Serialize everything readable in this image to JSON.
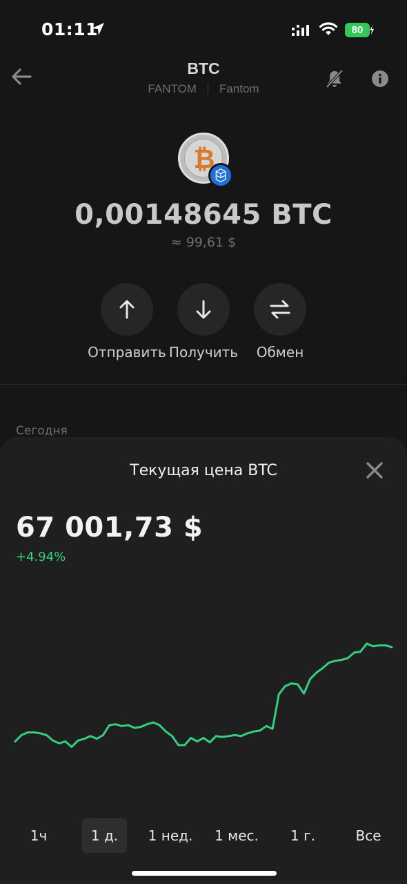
{
  "status_bar": {
    "time": "01:11",
    "battery": "80"
  },
  "header": {
    "title": "BTC",
    "network": "FANTOM",
    "network_name": "Fantom"
  },
  "asset": {
    "balance": "0,00148645 BTC",
    "fiat_value": "≈ 99,61 $"
  },
  "actions": [
    {
      "label": "Отправить",
      "icon": "arrow-up-icon"
    },
    {
      "label": "Получить",
      "icon": "arrow-down-icon"
    },
    {
      "label": "Обмен",
      "icon": "swap-icon"
    }
  ],
  "history": {
    "section_label": "Сегодня"
  },
  "price_sheet": {
    "title": "Текущая цена BTC",
    "price": "67 001,73 $",
    "change": "+4.94%",
    "ranges": [
      {
        "label": "1ч",
        "active": false
      },
      {
        "label": "1 д.",
        "active": true
      },
      {
        "label": "1 нед.",
        "active": false
      },
      {
        "label": "1 мес.",
        "active": false
      },
      {
        "label": "1 г.",
        "active": false
      },
      {
        "label": "Все",
        "active": false
      }
    ]
  },
  "colors": {
    "accent_green": "#35d07f",
    "background": "#161616",
    "sheet": "#1f1f1f",
    "btc_orange": "#d87a2a",
    "fantom_blue": "#1f6fd8"
  },
  "chart_data": {
    "type": "line",
    "x": [
      0,
      1,
      2,
      3,
      4,
      5,
      6,
      7,
      8,
      9,
      10,
      11,
      12,
      13,
      14,
      15,
      16,
      17,
      18,
      19,
      20,
      21,
      22,
      23,
      24,
      25,
      26,
      27,
      28,
      29,
      30,
      31,
      32,
      33,
      34,
      35,
      36,
      37,
      38,
      39,
      40,
      41,
      42,
      43,
      44,
      45,
      46,
      47,
      48,
      49,
      50,
      51,
      52,
      53,
      54,
      55,
      56,
      57,
      58,
      59,
      60
    ],
    "series": [
      {
        "values": [
          64000,
          64070,
          64100,
          64100,
          64090,
          64070,
          64010,
          63980,
          64000,
          63940,
          64010,
          64030,
          64060,
          64030,
          64070,
          64180,
          64190,
          64170,
          64180,
          64150,
          64160,
          64190,
          64210,
          64180,
          64110,
          64060,
          63960,
          63960,
          64040,
          64000,
          64040,
          63990,
          64060,
          64050,
          64060,
          64070,
          64060,
          64090,
          64110,
          64120,
          64170,
          64140,
          64520,
          64610,
          64640,
          64630,
          64530,
          64690,
          64760,
          64810,
          64870,
          64890,
          64900,
          64920,
          64980,
          64990,
          65080,
          65050,
          65060,
          65060,
          65040
        ]
      }
    ],
    "ylim": [
      63700,
      65300
    ],
    "grid": false,
    "legend": "none"
  }
}
